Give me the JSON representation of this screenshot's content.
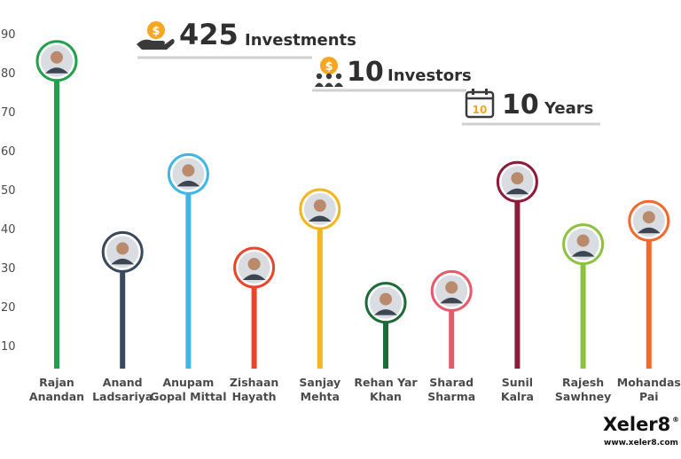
{
  "chart_data": {
    "type": "lollipop",
    "ylim": [
      5,
      90
    ],
    "yticks": [
      10,
      20,
      30,
      40,
      50,
      60,
      70,
      80,
      90
    ],
    "grid": false,
    "series": [
      {
        "values": [
          83,
          34,
          54,
          30,
          45,
          21,
          24,
          52,
          36,
          42
        ]
      }
    ],
    "categories": [
      {
        "line1": "Rajan",
        "line2": "Anandan",
        "color": "#22a04b"
      },
      {
        "line1": "Anand",
        "line2": "Ladsariya",
        "color": "#3a4a5e"
      },
      {
        "line1": "Anupam",
        "line2": "Gopal Mittal",
        "color": "#3fb6e6"
      },
      {
        "line1": "Zishaan",
        "line2": "Hayath",
        "color": "#e8452c"
      },
      {
        "line1": "Sanjay",
        "line2": "Mehta",
        "color": "#f2b51f"
      },
      {
        "line1": "Rehan Yar",
        "line2": "Khan",
        "color": "#1e6b38"
      },
      {
        "line1": "Sharad",
        "line2": "Sharma",
        "color": "#e75a6b"
      },
      {
        "line1": "Sunil",
        "line2": "Kalra",
        "color": "#8c1d3a"
      },
      {
        "line1": "Rajesh",
        "line2": "Sawhney",
        "color": "#8cc23f"
      },
      {
        "line1": "Mohandas",
        "line2": "Pai",
        "color": "#f06a2b"
      }
    ]
  },
  "stats": [
    {
      "number": "425",
      "label": "Investments",
      "icon": "hand-coin-icon"
    },
    {
      "number": "10",
      "label": "Investors",
      "icon": "investors-coin-icon"
    },
    {
      "number": "10",
      "label": "Years",
      "icon": "calendar-icon",
      "icon_text": "10"
    }
  ],
  "colors": {
    "accent": "#f5a623",
    "icon_dark": "#3a3a3a",
    "underline": "#d0d0d0"
  },
  "brand": {
    "name": "Xeler8",
    "mark": "®",
    "url": "www.xeler8.com"
  }
}
